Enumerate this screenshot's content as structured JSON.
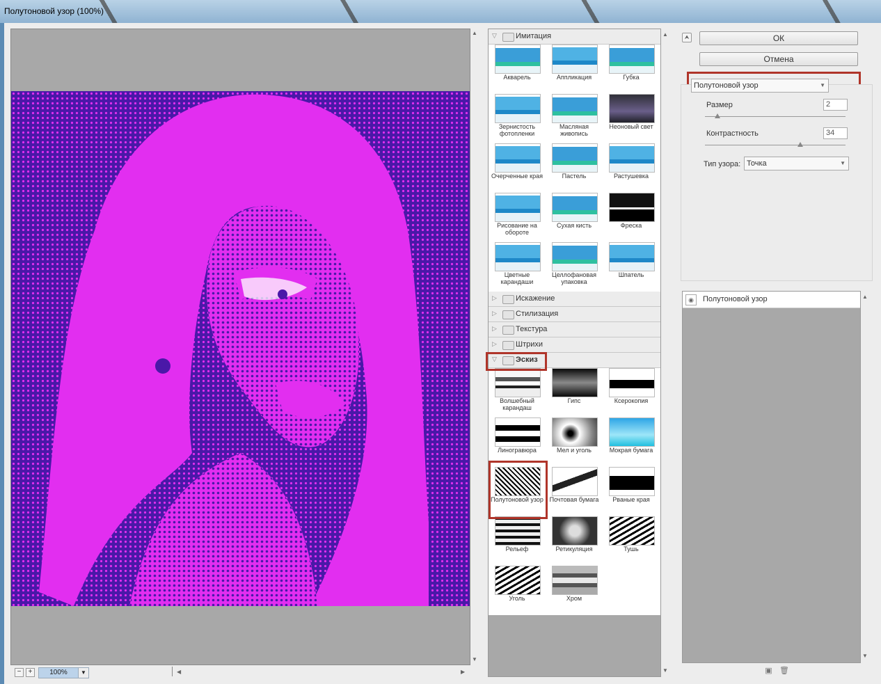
{
  "window": {
    "title": "Полутоновой узор (100%)"
  },
  "preview": {
    "zoom": "100%",
    "zoom_out": "−",
    "zoom_in": "+",
    "zoom_dropdown": "▼"
  },
  "gallery": {
    "imitation": {
      "label": "Имитация",
      "items": [
        "Акварель",
        "Аппликация",
        "Губка",
        "Зернистость фотопленки",
        "Масляная живопись",
        "Неоновый свет",
        "Очерченные края",
        "Пастель",
        "Растушевка",
        "Рисование на обороте",
        "Сухая кисть",
        "Фреска",
        "Цветные карандаши",
        "Целлофановая упаковка",
        "Шпатель"
      ]
    },
    "collapsed_categories": [
      "Искажение",
      "Стилизация",
      "Текстура",
      "Штрихи"
    ],
    "sketch": {
      "label": "Эскиз",
      "items": [
        "Волшебный карандаш",
        "Гипс",
        "Ксерокопия",
        "Линогравюра",
        "Мел и уголь",
        "Мокрая бумага",
        "Полутоновой узор",
        "Почтовая бумага",
        "Рваные края",
        "Рельеф",
        "Ретикуляция",
        "Тушь",
        "Уголь",
        "Хром"
      ],
      "selected": "Полутоновой узор"
    }
  },
  "buttons": {
    "ok": "ОК",
    "cancel": "Отмена"
  },
  "settings": {
    "filter": "Полутоновой узор",
    "size_label": "Размер",
    "size_value": "2",
    "size_fraction": 0.09,
    "contrast_label": "Контрастность",
    "contrast_value": "34",
    "contrast_fraction": 0.68,
    "pattern_label": "Тип узора:",
    "pattern_value": "Точка"
  },
  "layers": {
    "items": [
      "Полутоновой узор"
    ]
  },
  "icons": {
    "collapse": "⮝",
    "eye": "◉",
    "new_layer": "▣",
    "delete": "🗑"
  },
  "colors": {
    "halftone_light": "#e22ef0",
    "halftone_dark": "#4a18a8",
    "highlight": "#b0352a"
  }
}
